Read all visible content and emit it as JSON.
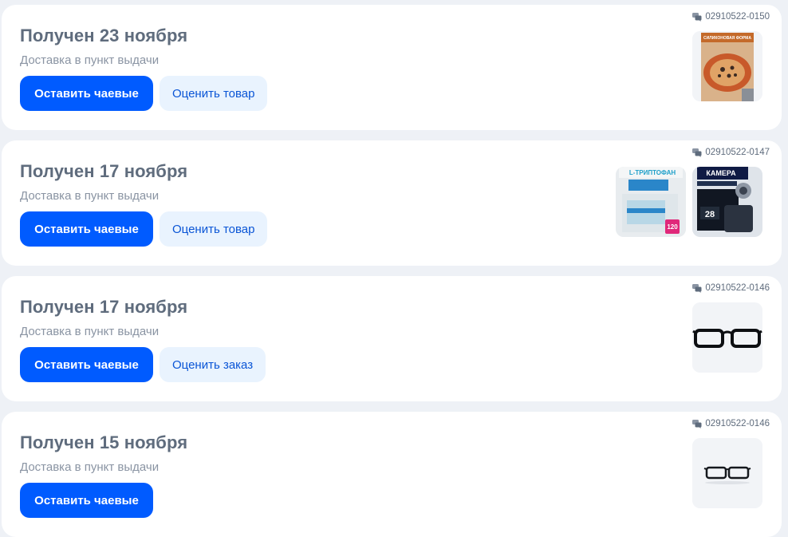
{
  "orders": [
    {
      "title": "Получен 23 ноября",
      "subtitle": "Доставка в пункт выдачи",
      "tip_label": "Оставить чаевые",
      "rate_label": "Оценить товар",
      "order_id": "02910522-0150",
      "thumbs": [
        {
          "kind": "baking-mold-product",
          "text": "СИЛИКОНОВАЯ ФОРМА"
        }
      ]
    },
    {
      "title": "Получен 17 ноября",
      "subtitle": "Доставка в пункт выдачи",
      "tip_label": "Оставить чаевые",
      "rate_label": "Оценить товар",
      "order_id": "02910522-0147",
      "thumbs": [
        {
          "kind": "tryptophan-product",
          "text": "L-ТРИПТОФАН",
          "badge": "120"
        },
        {
          "kind": "camera-product",
          "text": "КАМЕРА",
          "badge": "28"
        }
      ]
    },
    {
      "title": "Получен 17 ноября",
      "subtitle": "Доставка в пункт выдачи",
      "tip_label": "Оставить чаевые",
      "rate_label": "Оценить заказ",
      "order_id": "02910522-0146",
      "thumbs": [
        {
          "kind": "glasses-product"
        }
      ]
    },
    {
      "title": "Получен 15 ноября",
      "subtitle": "Доставка в пункт выдачи",
      "tip_label": "Оставить чаевые",
      "rate_label": null,
      "order_id": "02910522-0146",
      "thumbs": [
        {
          "kind": "glasses-product-small"
        }
      ]
    }
  ],
  "colors": {
    "accent": "#005bff",
    "secondary_bg": "#e9f3fe",
    "secondary_text": "#0a55d6",
    "title": "#5f6c7d",
    "subtitle": "#8a94a3",
    "page_bg": "#eef1f6"
  },
  "icons": {
    "order_id": "chat-bubbles-icon"
  }
}
